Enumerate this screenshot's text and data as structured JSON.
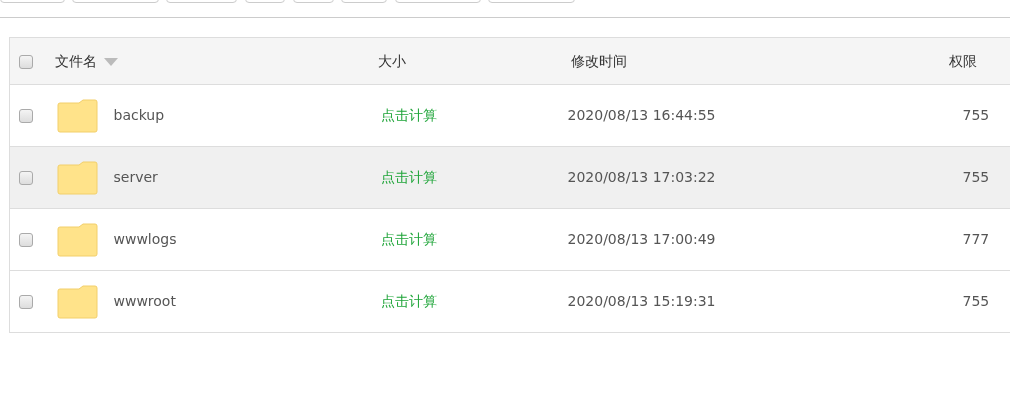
{
  "toolbar": [
    {
      "kind": "button"
    },
    {
      "kind": "button"
    },
    {
      "kind": "button"
    },
    {
      "kind": "button"
    },
    {
      "kind": "button"
    },
    {
      "kind": "button"
    },
    {
      "kind": "button"
    },
    {
      "kind": "button"
    }
  ],
  "table": {
    "select_all": {
      "checked": false
    },
    "columns": [
      {
        "label": "文件名",
        "sorted": true
      },
      {
        "label": "大小",
        "sorted": false
      },
      {
        "label": "修改时间",
        "sorted": false
      },
      {
        "label": "权限",
        "sorted": false
      }
    ],
    "rows": [
      {
        "checked": false,
        "selected": false,
        "name": "backup",
        "size": "点击计算",
        "modified": "2020/08/13 16:44:55",
        "permission": "755"
      },
      {
        "checked": false,
        "selected": true,
        "name": "server",
        "size": "点击计算",
        "modified": "2020/08/13 17:03:22",
        "permission": "755"
      },
      {
        "checked": false,
        "selected": false,
        "name": "wwwlogs",
        "size": "点击计算",
        "modified": "2020/08/13 17:00:49",
        "permission": "777"
      },
      {
        "checked": false,
        "selected": false,
        "name": "wwwroot",
        "size": "点击计算",
        "modified": "2020/08/13 15:19:31",
        "permission": "755"
      }
    ]
  }
}
